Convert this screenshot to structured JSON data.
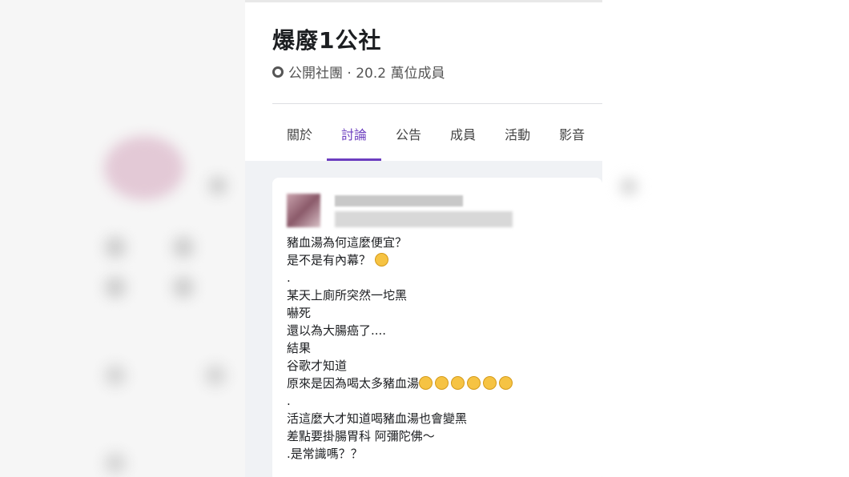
{
  "group": {
    "title": "爆廢1公社",
    "meta": "公開社團 · 20.2 萬位成員",
    "globe_icon": "globe-icon"
  },
  "tabs": [
    {
      "label": "關於",
      "active": false
    },
    {
      "label": "討論",
      "active": true
    },
    {
      "label": "公告",
      "active": false
    },
    {
      "label": "成員",
      "active": false
    },
    {
      "label": "活動",
      "active": false
    },
    {
      "label": "影音",
      "active": false
    }
  ],
  "post": {
    "lines": [
      "豬血湯為何這麼便宜？",
      "是不是有內幕？",
      ".",
      "某天上廁所突然一坨黑",
      "嚇死",
      "還以為大腸癌了....",
      "結果",
      "谷歌才知道",
      "原來是因為喝太多豬血湯",
      ".",
      "活這麼大才知道喝豬血湯也會變黑",
      "差點要掛腸胃科 阿彌陀佛～",
      ".是常識嗎？？"
    ]
  },
  "colors": {
    "accent": "#6c3ebf",
    "background": "#f0f2f5"
  }
}
